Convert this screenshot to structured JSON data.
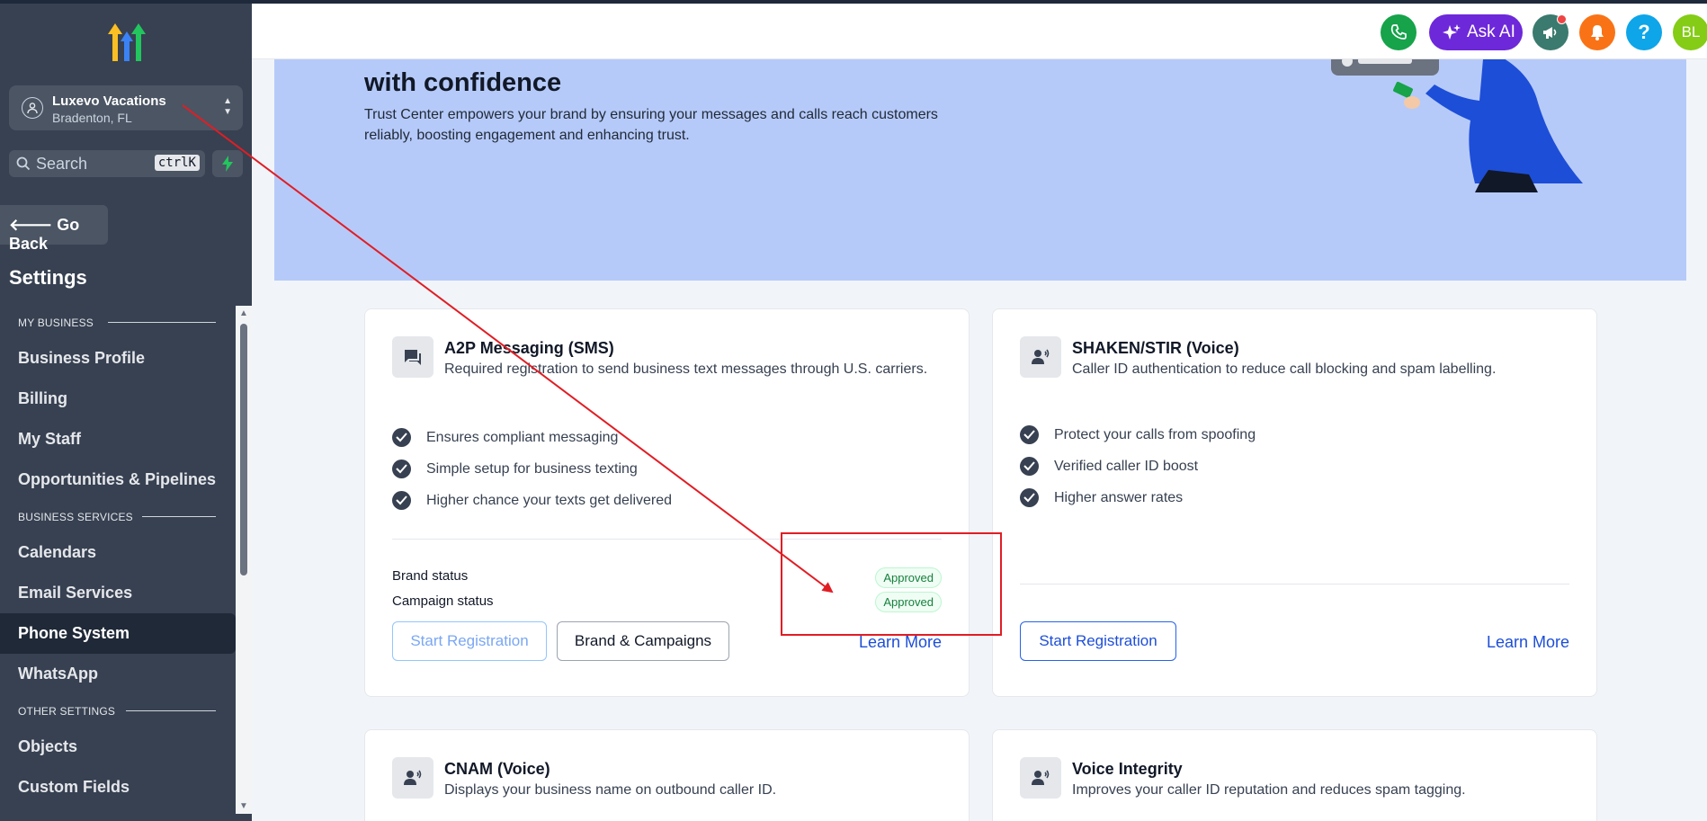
{
  "sidebar": {
    "location_name": "Luxevo Vacations",
    "location_city": "Bradenton, FL",
    "search_placeholder": "Search",
    "search_shortcut": "ctrlK",
    "go_back": "Go Back",
    "title": "Settings",
    "sections": [
      {
        "label": "MY BUSINESS",
        "items": [
          "Business Profile",
          "Billing",
          "My Staff",
          "Opportunities & Pipelines"
        ]
      },
      {
        "label": "BUSINESS SERVICES",
        "items": [
          "Calendars",
          "Email Services",
          "Phone System",
          "WhatsApp"
        ]
      },
      {
        "label": "OTHER SETTINGS",
        "items": [
          "Objects",
          "Custom Fields"
        ]
      }
    ],
    "active_item": "Phone System"
  },
  "header": {
    "ask_ai": "Ask AI",
    "help": "?",
    "avatar": "BL"
  },
  "hero": {
    "title": "with confidence",
    "description": "Trust Center empowers your brand by ensuring your messages and calls reach customers reliably, boosting engagement and enhancing trust."
  },
  "cards": {
    "a2p": {
      "title": "A2P Messaging (SMS)",
      "subtitle": "Required registration to send business text messages through U.S. carriers.",
      "features": [
        "Ensures compliant messaging",
        "Simple setup for business texting",
        "Higher chance your texts get delivered"
      ],
      "brand_status_label": "Brand status",
      "brand_status": "Approved",
      "campaign_status_label": "Campaign status",
      "campaign_status": "Approved",
      "start_registration": "Start Registration",
      "brand_campaigns": "Brand & Campaigns",
      "learn_more": "Learn More"
    },
    "shaken": {
      "title": "SHAKEN/STIR (Voice)",
      "subtitle": "Caller ID authentication to reduce call blocking and spam labelling.",
      "features": [
        "Protect your calls from spoofing",
        "Verified caller ID boost",
        "Higher answer rates"
      ],
      "start_registration": "Start Registration",
      "learn_more": "Learn More"
    },
    "cnam": {
      "title": "CNAM (Voice)",
      "subtitle": "Displays your business name on outbound caller ID."
    },
    "voice_integrity": {
      "title": "Voice Integrity",
      "subtitle": "Improves your caller ID reputation and reduces spam tagging."
    }
  },
  "colors": {
    "sidebar_bg": "#374151",
    "hero_bg": "#b6caf9",
    "accent_blue": "#1d4ed8",
    "approved_green": "#15803d",
    "annotation_red": "#e11d24"
  }
}
